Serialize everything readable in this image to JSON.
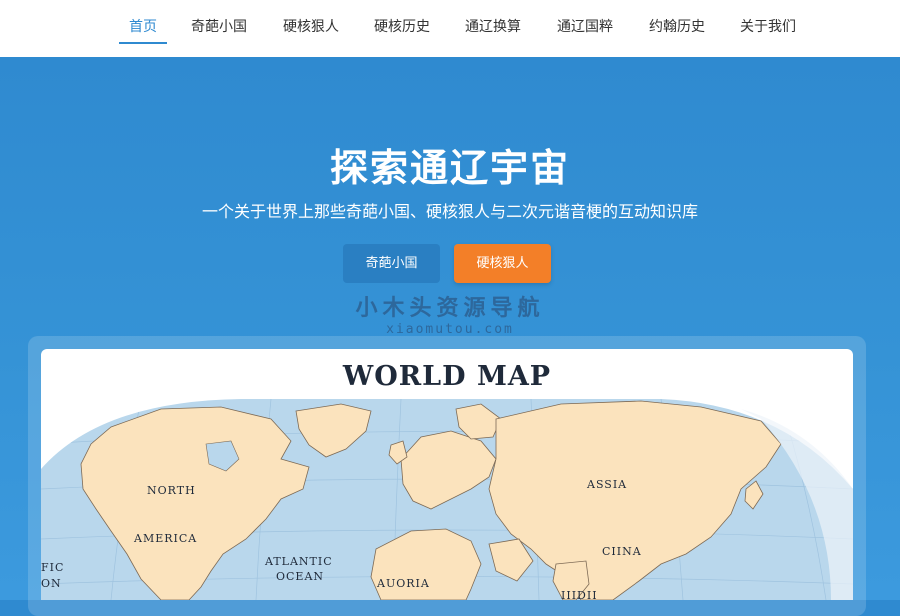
{
  "nav": {
    "items": [
      {
        "label": "首页",
        "active": true
      },
      {
        "label": "奇葩小国",
        "active": false
      },
      {
        "label": "硬核狠人",
        "active": false
      },
      {
        "label": "硬核历史",
        "active": false
      },
      {
        "label": "通辽换算",
        "active": false
      },
      {
        "label": "通辽国粹",
        "active": false
      },
      {
        "label": "约翰历史",
        "active": false
      },
      {
        "label": "关于我们",
        "active": false
      }
    ]
  },
  "hero": {
    "title": "探索通辽宇宙",
    "subtitle": "一个关于世界上那些奇葩小国、硬核狠人与二次元谐音梗的互动知识库",
    "buttons": {
      "secondary": "奇葩小国",
      "primary": "硬核狠人"
    }
  },
  "watermark": {
    "cn": "小木头资源导航",
    "en": "xiaomutou.com"
  },
  "map": {
    "title": "WORLD MAP",
    "labels": {
      "north": "NORTH",
      "america": "AMERICA",
      "atlantic": "ATLANTIC",
      "ocean": "OCEAN",
      "pacific_partial": "FIC",
      "pacific_partial2": "ON",
      "asia": "ASSIA",
      "china": "CIINA",
      "africa_partial": "AUORIA",
      "india_partial": "IIIDII"
    }
  },
  "colors": {
    "brand_blue": "#2f8ad0",
    "accent_orange": "#f37f28",
    "land": "#fbe3bd",
    "sea": "#b9d7ec"
  }
}
